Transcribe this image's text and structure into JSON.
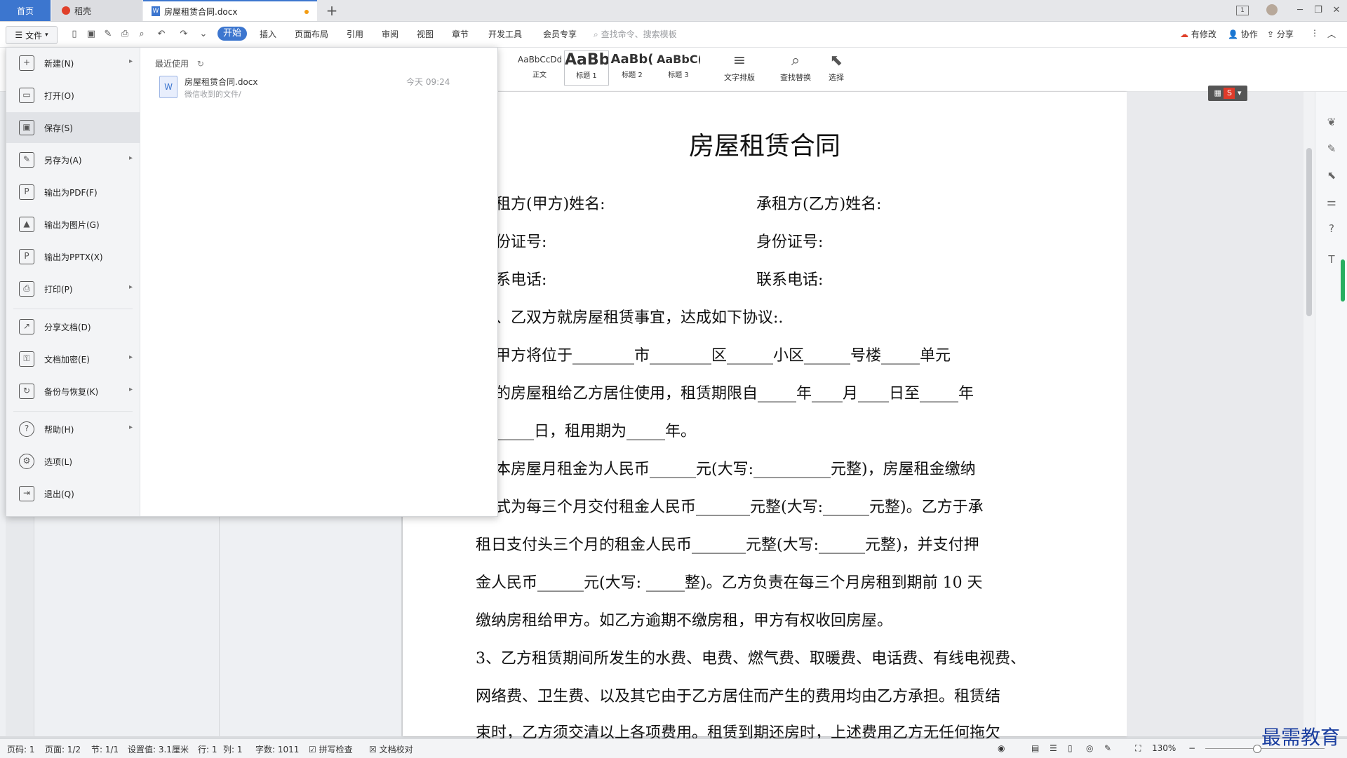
{
  "tabs": {
    "home": "首页",
    "daoke": "稻壳",
    "doc": "房屋租赁合同.docx",
    "add": "+"
  },
  "window": {
    "badge": "1"
  },
  "menubar": {
    "file": "文件",
    "tabs": [
      "开始",
      "插入",
      "页面布局",
      "引用",
      "审阅",
      "视图",
      "章节",
      "开发工具",
      "会员专享"
    ],
    "search": "查找命令、搜索模板",
    "right": {
      "modified": "有修改",
      "collab": "协作",
      "share": "分享"
    }
  },
  "ribbon": {
    "styles": [
      {
        "sample": "AaBbCcDd",
        "name": "正文"
      },
      {
        "sample": "AaBb",
        "name": "标题 1"
      },
      {
        "sample": "AaBb(",
        "name": "标题 2"
      },
      {
        "sample": "AaBbC(",
        "name": "标题 3"
      }
    ],
    "text_layout": "文字排版",
    "find_replace": "查找替换",
    "select": "选择"
  },
  "file_menu": {
    "items": [
      {
        "label": "新建(N)",
        "icon": "new-doc-icon",
        "arrow": true
      },
      {
        "label": "打开(O)",
        "icon": "folder-open-icon",
        "arrow": false
      },
      {
        "label": "保存(S)",
        "icon": "save-icon",
        "arrow": false
      },
      {
        "label": "另存为(A)",
        "icon": "save-as-icon",
        "arrow": true
      },
      {
        "label": "输出为PDF(F)",
        "icon": "pdf-icon",
        "arrow": false
      },
      {
        "label": "输出为图片(G)",
        "icon": "image-export-icon",
        "arrow": false
      },
      {
        "label": "输出为PPTX(X)",
        "icon": "pptx-icon",
        "arrow": false
      },
      {
        "label": "打印(P)",
        "icon": "print-icon",
        "arrow": true
      },
      {
        "label": "分享文档(D)",
        "icon": "share-icon",
        "arrow": false
      },
      {
        "label": "文档加密(E)",
        "icon": "encrypt-icon",
        "arrow": true
      },
      {
        "label": "备份与恢复(K)",
        "icon": "backup-icon",
        "arrow": true
      },
      {
        "label": "帮助(H)",
        "icon": "help-icon",
        "arrow": true
      },
      {
        "label": "选项(L)",
        "icon": "options-icon",
        "arrow": false
      },
      {
        "label": "退出(Q)",
        "icon": "exit-icon",
        "arrow": false
      }
    ],
    "recent_header": "最近使用",
    "recent": {
      "name": "房屋租赁合同.docx",
      "path": "微信收到的文件/",
      "time": "今天 09:24"
    }
  },
  "document": {
    "title": "房屋租赁合同",
    "lines": [
      "租方(甲方)姓名:",
      "承租方(乙方)姓名:",
      "份证号:",
      "身份证号:",
      "系电话:",
      "联系电话:",
      "、乙双方就房屋租赁事宜，达成如下协议:.",
      " 甲方将位于________市________区______小区______号楼_____单元",
      "的房屋租给乙方居住使用，租赁期限自_____年____月____日至_____年",
      "_____日，租用期为_____年。",
      " 本房屋月租金为人民币______元(大写:__________元整)，房屋租金缴纳",
      "式为每三个月交付租金人民币_______元整(大写:______元整)。乙方于承",
      "租日支付头三个月的租金人民币_______元整(大写:______元整)，并支付押",
      "金人民币______元(大写: _____整)。乙方负责在每三个月房租到期前 10 天",
      "缴纳房租给甲方。如乙方逾期不缴房租，甲方有权收回房屋。",
      "3、乙方租赁期间所发生的水费、电费、燃气费、取暖费、电话费、有线电视费、",
      "网络费、卫生费、以及其它由于乙方居住而产生的费用均由乙方承担。租赁结",
      "束时，乙方须交清以上各项费用。租赁到期还房时，上述费用乙方无任何拖欠"
    ]
  },
  "statusbar": {
    "page_num": "页码: 1",
    "pages": "页面: 1/2",
    "section": "节: 1/1",
    "setting": "设置值: 3.1厘米",
    "row": "行: 1",
    "col": "列: 1",
    "words": "字数: 1011",
    "spell": "拼写检查",
    "proof": "文档校对",
    "zoom": "130%"
  },
  "watermark": "最需教育",
  "colors": {
    "accent": "#3c76cf",
    "modified_dot": "#f39c12",
    "green": "#27ae60"
  }
}
